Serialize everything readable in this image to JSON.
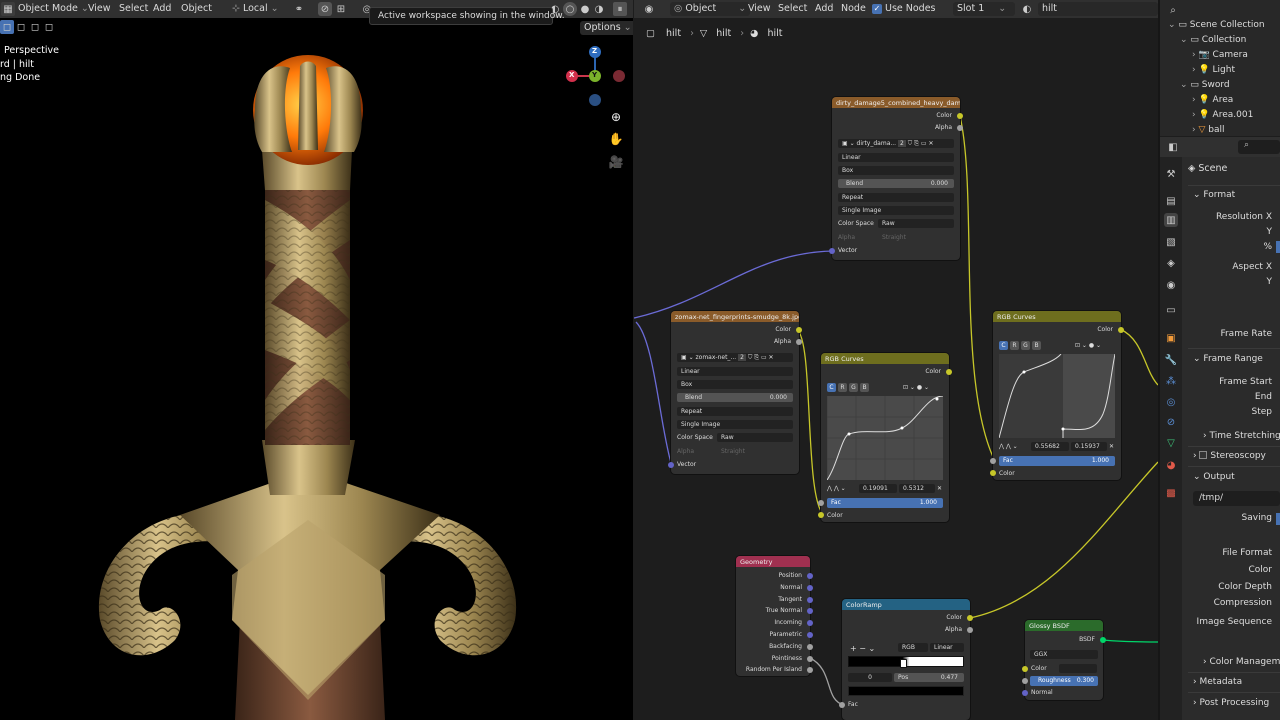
{
  "viewport": {
    "header": {
      "mode": "Object Mode",
      "menus": [
        "View",
        "Select",
        "Add",
        "Object"
      ],
      "transform": "Local",
      "options": "Options"
    },
    "tooltip": "Active workspace showing in the window.",
    "overlay": [
      "Perspective",
      "rd | hilt",
      "ng Done"
    ],
    "gizmo": {
      "z": "Z",
      "y": "Y",
      "x": "X"
    }
  },
  "node_editor": {
    "header": {
      "type": "Object",
      "menus": [
        "View",
        "Select",
        "Add",
        "Node"
      ],
      "use_nodes": "Use Nodes",
      "slot": "Slot 1",
      "material": "hilt"
    },
    "breadcrumb": [
      "hilt",
      "hilt",
      "hilt"
    ],
    "nodes": {
      "tex1": {
        "title": "dirty_damage5_combined_heavy_dam...",
        "out_color": "Color",
        "out_alpha": "Alpha",
        "image": "dirty_dama...",
        "users": "2",
        "interp": "Linear",
        "proj": "Box",
        "blend_label": "Blend",
        "blend_val": "0.000",
        "ext": "Repeat",
        "src": "Single Image",
        "cs_label": "Color Space",
        "cs_val": "Raw",
        "alpha_label": "Alpha",
        "alpha_val": "Straight",
        "in_vector": "Vector"
      },
      "tex2": {
        "title": "zomax-net_fingerprints-smudge_8k.jpg",
        "out_color": "Color",
        "out_alpha": "Alpha",
        "image": "zomax-net_...",
        "users": "2",
        "interp": "Linear",
        "proj": "Box",
        "blend_label": "Blend",
        "blend_val": "0.000",
        "ext": "Repeat",
        "src": "Single Image",
        "cs_label": "Color Space",
        "cs_val": "Raw",
        "alpha_label": "Alpha",
        "alpha_val": "Straight",
        "in_vector": "Vector"
      },
      "curves1": {
        "title": "RGB Curves",
        "out_color": "Color",
        "tabs": [
          "C",
          "R",
          "G",
          "B"
        ],
        "pt_x": "0.19091",
        "pt_y": "0.5312",
        "fac_label": "Fac",
        "fac_val": "1.000",
        "in_color": "Color"
      },
      "curves2": {
        "title": "RGB Curves",
        "out_color": "Color",
        "tabs": [
          "C",
          "R",
          "G",
          "B"
        ],
        "pt_x": "0.55682",
        "pt_y": "0.15937",
        "fac_label": "Fac",
        "fac_val": "1.000",
        "in_color": "Color"
      },
      "geometry": {
        "title": "Geometry",
        "outputs": [
          "Position",
          "Normal",
          "Tangent",
          "True Normal",
          "Incoming",
          "Parametric",
          "Backfacing",
          "Pointiness",
          "Random Per Island"
        ]
      },
      "ramp": {
        "title": "ColorRamp",
        "out_color": "Color",
        "out_alpha": "Alpha",
        "mode": "RGB",
        "interp": "Linear",
        "index": "0",
        "pos_label": "Pos",
        "pos_val": "0.477",
        "in_fac": "Fac"
      },
      "glossy": {
        "title": "Glossy BSDF",
        "out": "BSDF",
        "dist": "GGX",
        "color": "Color",
        "rough_label": "Roughness",
        "rough_val": "0.300",
        "normal": "Normal"
      }
    }
  },
  "outliner": {
    "items": [
      {
        "label": "Scene Collection",
        "indent": 0
      },
      {
        "label": "Collection",
        "indent": 1
      },
      {
        "label": "Camera",
        "indent": 2
      },
      {
        "label": "Light",
        "indent": 2
      },
      {
        "label": "Sword",
        "indent": 1
      },
      {
        "label": "Area",
        "indent": 2
      },
      {
        "label": "Area.001",
        "indent": 2
      },
      {
        "label": "ball",
        "indent": 2
      }
    ]
  },
  "properties": {
    "context": "Scene",
    "format": "Format",
    "res_x": "Resolution X",
    "res_y": "Y",
    "res_pct": "%",
    "aspect_x": "Aspect X",
    "aspect_y": "Y",
    "frame_rate": "Frame Rate",
    "frame_range": "Frame Range",
    "frame_start": "Frame Start",
    "frame_end": "End",
    "frame_step": "Step",
    "time_stretching": "Time Stretching",
    "stereoscopy": "Stereoscopy",
    "output": "Output",
    "path": "/tmp/",
    "saving": "Saving",
    "file_format": "File Format",
    "color": "Color",
    "color_depth": "Color Depth",
    "compression": "Compression",
    "image_sequence": "Image Sequence",
    "color_mgmt": "Color Manageme...",
    "metadata": "Metadata",
    "post_processing": "Post Processing"
  }
}
